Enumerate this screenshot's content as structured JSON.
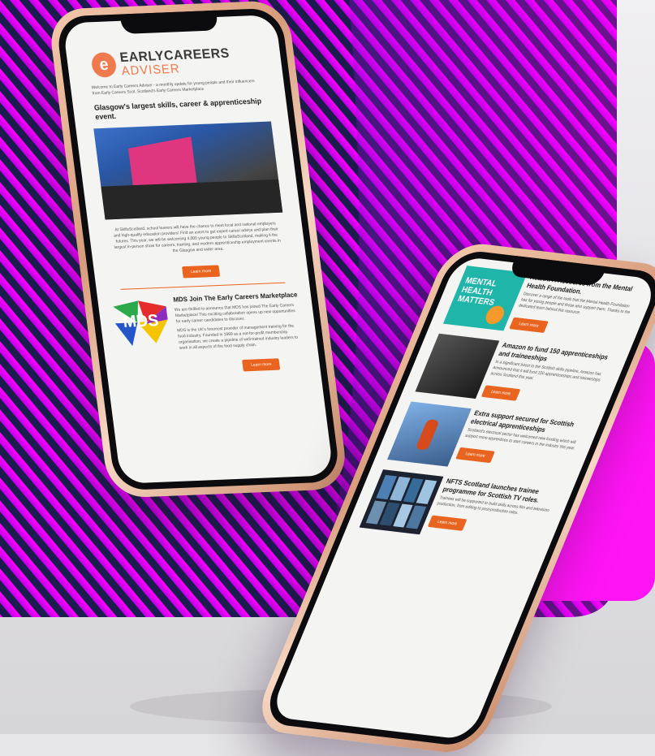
{
  "colors": {
    "magenta": "#f000f5",
    "navy": "#1a1f5e",
    "accent": "#e8641f",
    "bronze": "#d89c7b"
  },
  "phone_left": {
    "logo_top": "EARLYCAREERS",
    "logo_bottom": "ADVISER",
    "intro": "Welcome to Early Careers Adviser - a monthly update for young people and their influencers from Early Careers Scot, Scotland's Early Careers Marketplace",
    "headline": "Glasgow's largest skills, career & apprenticeship event.",
    "body": "At SkillsScotland, school leavers will have the chance to meet local and national employers and high-quality education providers! Find an event to get expert career advice and plan their futures. This year, we will be welcoming 4,000 young people to SkillsScotland, making it the largest in-person show for careers, training, and modern apprenticeship employment events in the Glasgow and wider area.",
    "button1": "Learn more",
    "article_title": "MDS Join The Early Careers Marketplace",
    "article_p1": "We are thrilled to announce that MDS has joined The Early Careers Marketplace! This exciting collaboration opens up new opportunities for early career candidates to discover.",
    "article_p2": "MDS is the UK's foremost provider of management training for the food industry. Founded in 1989 as a not-for-profit membership organisation, we create a pipeline of well-trained industry leaders to work in all aspects of the food supply chain.",
    "mds_logo": "MDS",
    "button2": "Learn more"
  },
  "phone_right": {
    "tile1_title": "Health: A Resource from the Mental Health Foundation.",
    "tile1_img_text": "MENTAL HEALTH MATTERS",
    "tile1_body": "Discover a range of the tools that the Mental Health Foundation has for young people and those who support them. Thanks to the dedicated team behind this resource.",
    "tile1_button": "Learn more",
    "tile2_title": "Amazon to fund 150 apprenticeships and traineeships",
    "tile2_body": "In a significant boost to the Scottish skills pipeline, Amazon has announced that it will fund 150 apprenticeships and traineeships across Scotland this year.",
    "tile2_button": "Learn more",
    "tile3_title": "Extra support secured for Scottish electrical apprenticeships",
    "tile3_body": "Scotland's electrical sector has welcomed new funding which will support more apprentices to start careers in the industry this year.",
    "tile3_button": "Learn more",
    "tile4_title": "NFTS Scotland launches trainee programme for Scottish TV roles.",
    "tile4_body": "Trainees will be supported to build skills across film and television production, from editing to post-production roles.",
    "tile4_button": "Learn more"
  }
}
